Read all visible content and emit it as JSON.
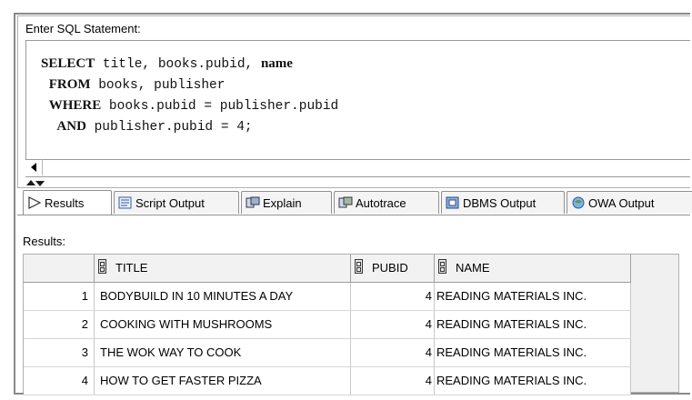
{
  "sql_panel": {
    "label": "Enter SQL Statement:",
    "lines": [
      {
        "kw": "SELECT",
        "rest": " title, books.pubid, ",
        "kw2": "name",
        "indent": ""
      },
      {
        "kw": "FROM",
        "rest": " books, publisher",
        "kw2": "",
        "indent": " "
      },
      {
        "kw": "WHERE",
        "rest": " books.pubid = publisher.pubid",
        "kw2": "",
        "indent": " "
      },
      {
        "kw": "AND",
        "rest": " publisher.pubid = 4;",
        "kw2": "",
        "indent": "  "
      }
    ]
  },
  "tabs": [
    {
      "label": "Results",
      "icon": "play-icon",
      "active": true
    },
    {
      "label": "Script Output",
      "icon": "script-icon",
      "active": false
    },
    {
      "label": "Explain",
      "icon": "explain-icon",
      "active": false
    },
    {
      "label": "Autotrace",
      "icon": "autotrace-icon",
      "active": false
    },
    {
      "label": "DBMS Output",
      "icon": "dbms-icon",
      "active": false
    },
    {
      "label": "OWA Output",
      "icon": "owa-icon",
      "active": false
    }
  ],
  "results_label": "Results:",
  "grid": {
    "columns": [
      "TITLE",
      "PUBID",
      "NAME"
    ],
    "rows": [
      {
        "num": "1",
        "title": "BODYBUILD IN 10 MINUTES A DAY",
        "pubid": "4",
        "name": "READING MATERIALS INC."
      },
      {
        "num": "2",
        "title": "COOKING WITH MUSHROOMS",
        "pubid": "4",
        "name": "READING MATERIALS INC."
      },
      {
        "num": "3",
        "title": "THE WOK WAY TO COOK",
        "pubid": "4",
        "name": "READING MATERIALS INC."
      },
      {
        "num": "4",
        "title": "HOW TO GET FASTER PIZZA",
        "pubid": "4",
        "name": "READING MATERIALS INC."
      }
    ]
  },
  "colors": {
    "frame_border": "#8a8a8a",
    "grid_background": "#f0f0f0",
    "tab_background": "#f4f4f4"
  }
}
